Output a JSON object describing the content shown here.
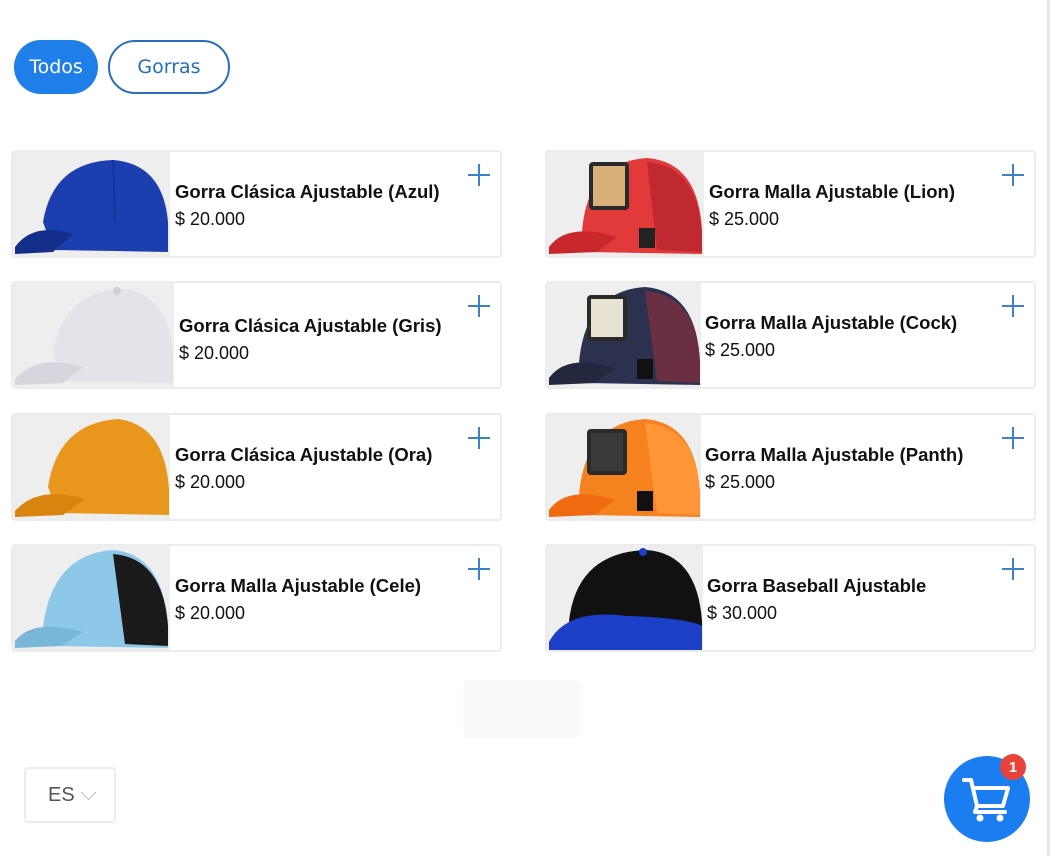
{
  "filters": [
    {
      "label": "Todos",
      "active": true
    },
    {
      "label": "Gorras",
      "active": false
    }
  ],
  "products": [
    {
      "name": "Gorra Clásica Ajustable (Azul)",
      "price": "$ 20.000",
      "icon": "cap-blue-image"
    },
    {
      "name": "Gorra Malla Ajustable (Lion)",
      "price": "$ 25.000",
      "icon": "trucker-cap-lion-image"
    },
    {
      "name": "Gorra Clásica Ajustable (Gris)",
      "price": "$ 20.000",
      "icon": "cap-gray-image"
    },
    {
      "name": "Gorra Malla Ajustable (Cock)",
      "price": "$ 25.000",
      "icon": "trucker-cap-cock-image"
    },
    {
      "name": "Gorra Clásica Ajustable (Ora)",
      "price": "$ 20.000",
      "icon": "cap-orange-image"
    },
    {
      "name": "Gorra Malla Ajustable (Panth)",
      "price": "$ 25.000",
      "icon": "trucker-cap-panther-image"
    },
    {
      "name": "Gorra Malla Ajustable (Cele)",
      "price": "$ 20.000",
      "icon": "trucker-cap-celeste-image"
    },
    {
      "name": "Gorra Baseball Ajustable",
      "price": "$ 30.000",
      "icon": "baseball-cap-black-image"
    }
  ],
  "language": {
    "code": "ES"
  },
  "cart": {
    "count": "1",
    "icon": "shopping-cart-icon"
  },
  "colors": {
    "accent": "#1f7fe8",
    "badge": "#e8433a",
    "plus": "#3b82c9"
  }
}
